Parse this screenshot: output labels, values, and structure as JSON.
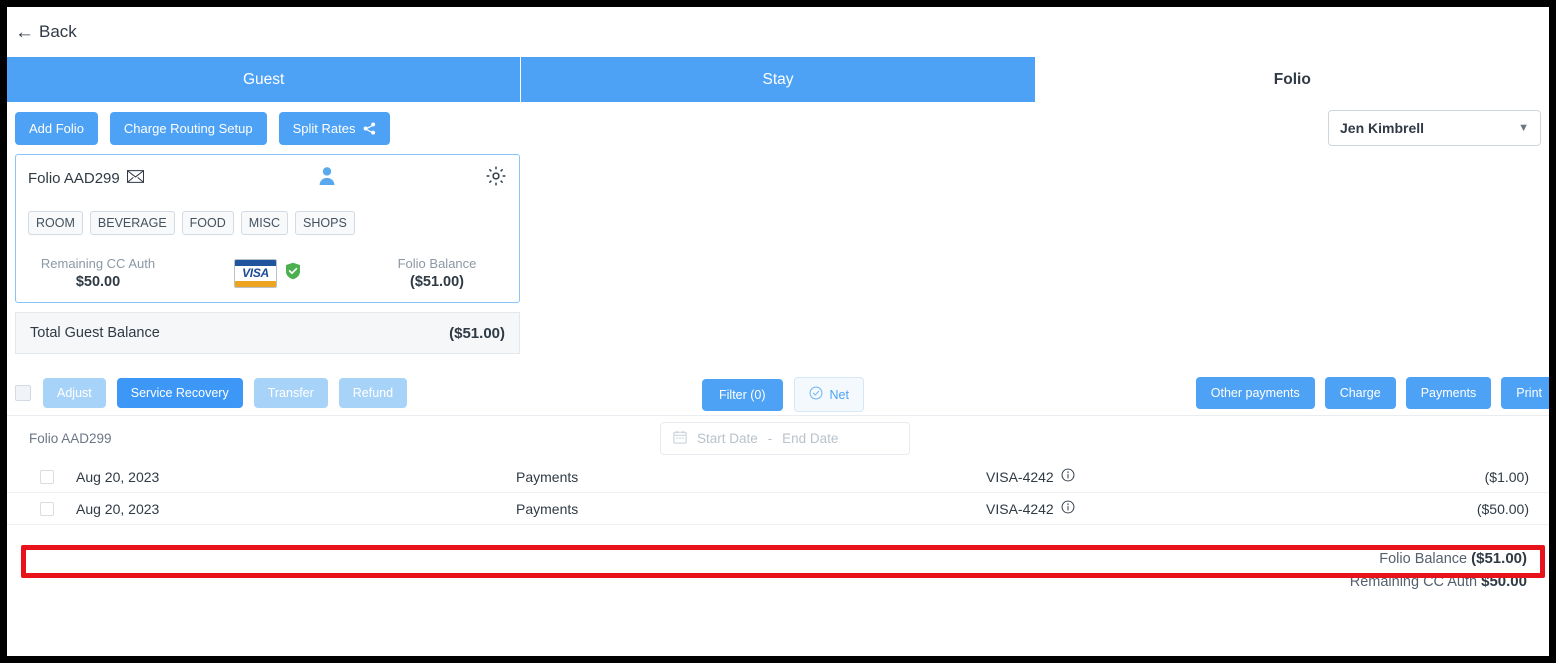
{
  "back": {
    "label": "Back",
    "icon": "arrow-left-icon"
  },
  "tabs": [
    {
      "label": "Guest",
      "active": true
    },
    {
      "label": "Stay",
      "active": true
    },
    {
      "label": "Folio",
      "active": false
    }
  ],
  "action_row": {
    "add_folio": "Add Folio",
    "charge_routing": "Charge Routing Setup",
    "split_rates": "Split Rates",
    "split_rates_icon": "share-icon",
    "guest_select": {
      "value": "Jen Kimbrell",
      "icon": "chevron-down-icon"
    }
  },
  "folio_card": {
    "title": "Folio AAD299",
    "mail_icon": "envelope-icon",
    "person_icon": "person-icon",
    "gear_icon": "gear-icon",
    "chips": [
      "ROOM",
      "BEVERAGE",
      "FOOD",
      "MISC",
      "SHOPS"
    ],
    "remaining_cc_auth_label": "Remaining CC Auth",
    "remaining_cc_auth_value": "$50.00",
    "card_brand": "VISA",
    "shield_icon": "shield-check-icon",
    "folio_balance_label": "Folio Balance",
    "folio_balance_value": "($51.00)"
  },
  "total_bar": {
    "label": "Total Guest Balance",
    "value": "($51.00)"
  },
  "toolbar": {
    "select_all_checkbox": "",
    "adjust": "Adjust",
    "service_recovery": "Service Recovery",
    "transfer": "Transfer",
    "refund": "Refund",
    "filter": "Filter (0)",
    "net": "Net",
    "net_icon": "check-circle-icon",
    "other_payments": "Other payments",
    "charge": "Charge",
    "payments": "Payments",
    "print": "Print"
  },
  "filter_row": {
    "folio_label": "Folio AAD299",
    "calendar_icon": "calendar-icon",
    "start_date_placeholder": "Start Date",
    "separator": "-",
    "end_date_placeholder": "End Date"
  },
  "table": {
    "rows": [
      {
        "date": "Aug 20, 2023",
        "type": "Payments",
        "card": "VISA-4242",
        "info_icon": "info-icon",
        "amount": "($1.00)",
        "highlighted": false
      },
      {
        "date": "Aug 20, 2023",
        "type": "Payments",
        "card": "VISA-4242",
        "info_icon": "info-icon",
        "amount": "($50.00)",
        "highlighted": true
      }
    ]
  },
  "footer": {
    "folio_balance_label": "Folio Balance",
    "folio_balance_value": "($51.00)",
    "remaining_cc_auth_label": "Remaining CC Auth",
    "remaining_cc_auth_value": "$50.00"
  },
  "colors": {
    "accent_blue": "#4da2f5",
    "active_blue": "#3d97f6",
    "disabled_blue": "#a8d3f9",
    "highlight_red": "#e8121a",
    "text_dark": "#2f3a45",
    "text_muted": "#8b98a5"
  }
}
